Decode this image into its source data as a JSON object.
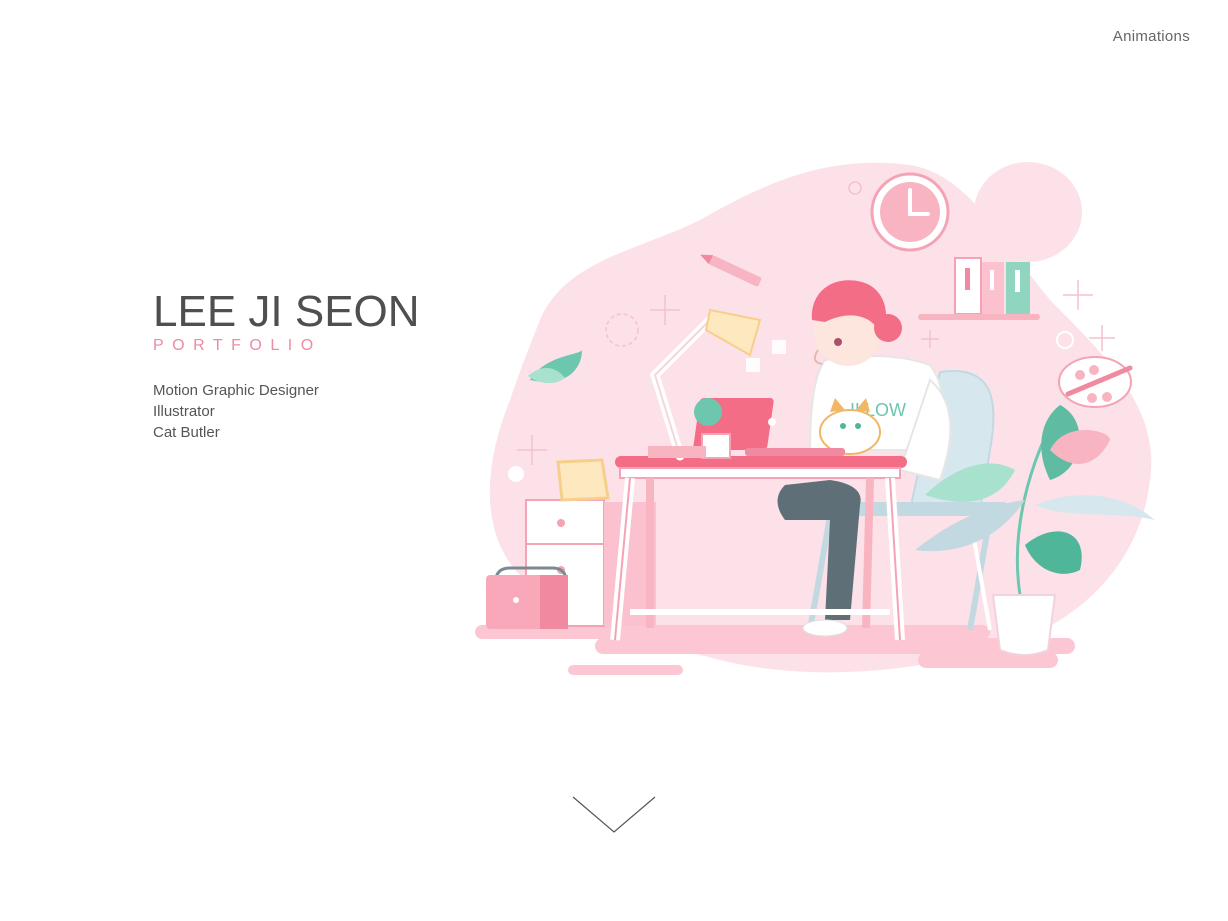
{
  "nav": {
    "animations_label": "Animations"
  },
  "intro": {
    "name": "LEE JI SEON",
    "subtitle": "PORTFOLIO",
    "roles": [
      "Motion Graphic Designer",
      "Illustrator",
      "Cat Butler"
    ]
  },
  "illustration": {
    "shirt_text": "ILLOW"
  },
  "colors": {
    "accent_pink": "#f08aa0",
    "blob_pink": "#fde1e8",
    "mint": "#6cc7ae",
    "text_dark": "#4f4f4f"
  },
  "icons": {
    "scroll": "chevron-down-icon"
  }
}
